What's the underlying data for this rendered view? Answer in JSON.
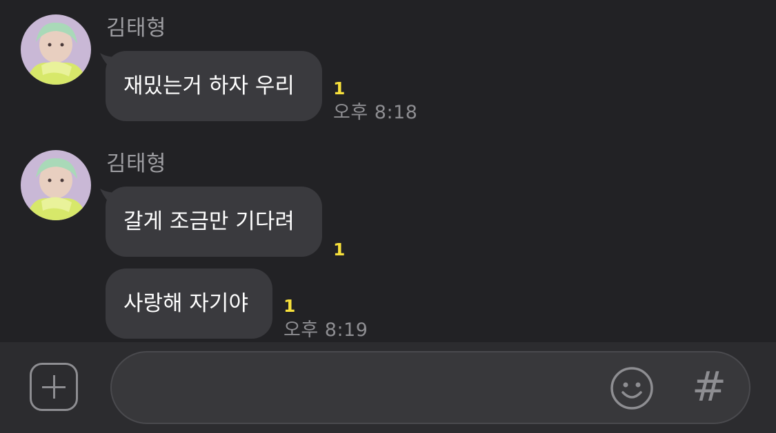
{
  "messages": [
    {
      "sender": "김태형",
      "text": "재밌는거 하자 우리",
      "unread": "1",
      "time": "오후 8:18"
    },
    {
      "sender": "김태형",
      "text": "갈게 조금만 기다려",
      "unread": "1"
    },
    {
      "text": "사랑해 자기야",
      "unread": "1",
      "time": "오후 8:19"
    }
  ],
  "input": {
    "placeholder": "",
    "attach_icon": "plus-icon",
    "emoji_icon": "emoji-icon",
    "hash_symbol": "#"
  },
  "colors": {
    "background": "#222225",
    "bubble": "#3a3a3e",
    "unread": "#f7e03b",
    "meta_text": "#8e8e92"
  }
}
